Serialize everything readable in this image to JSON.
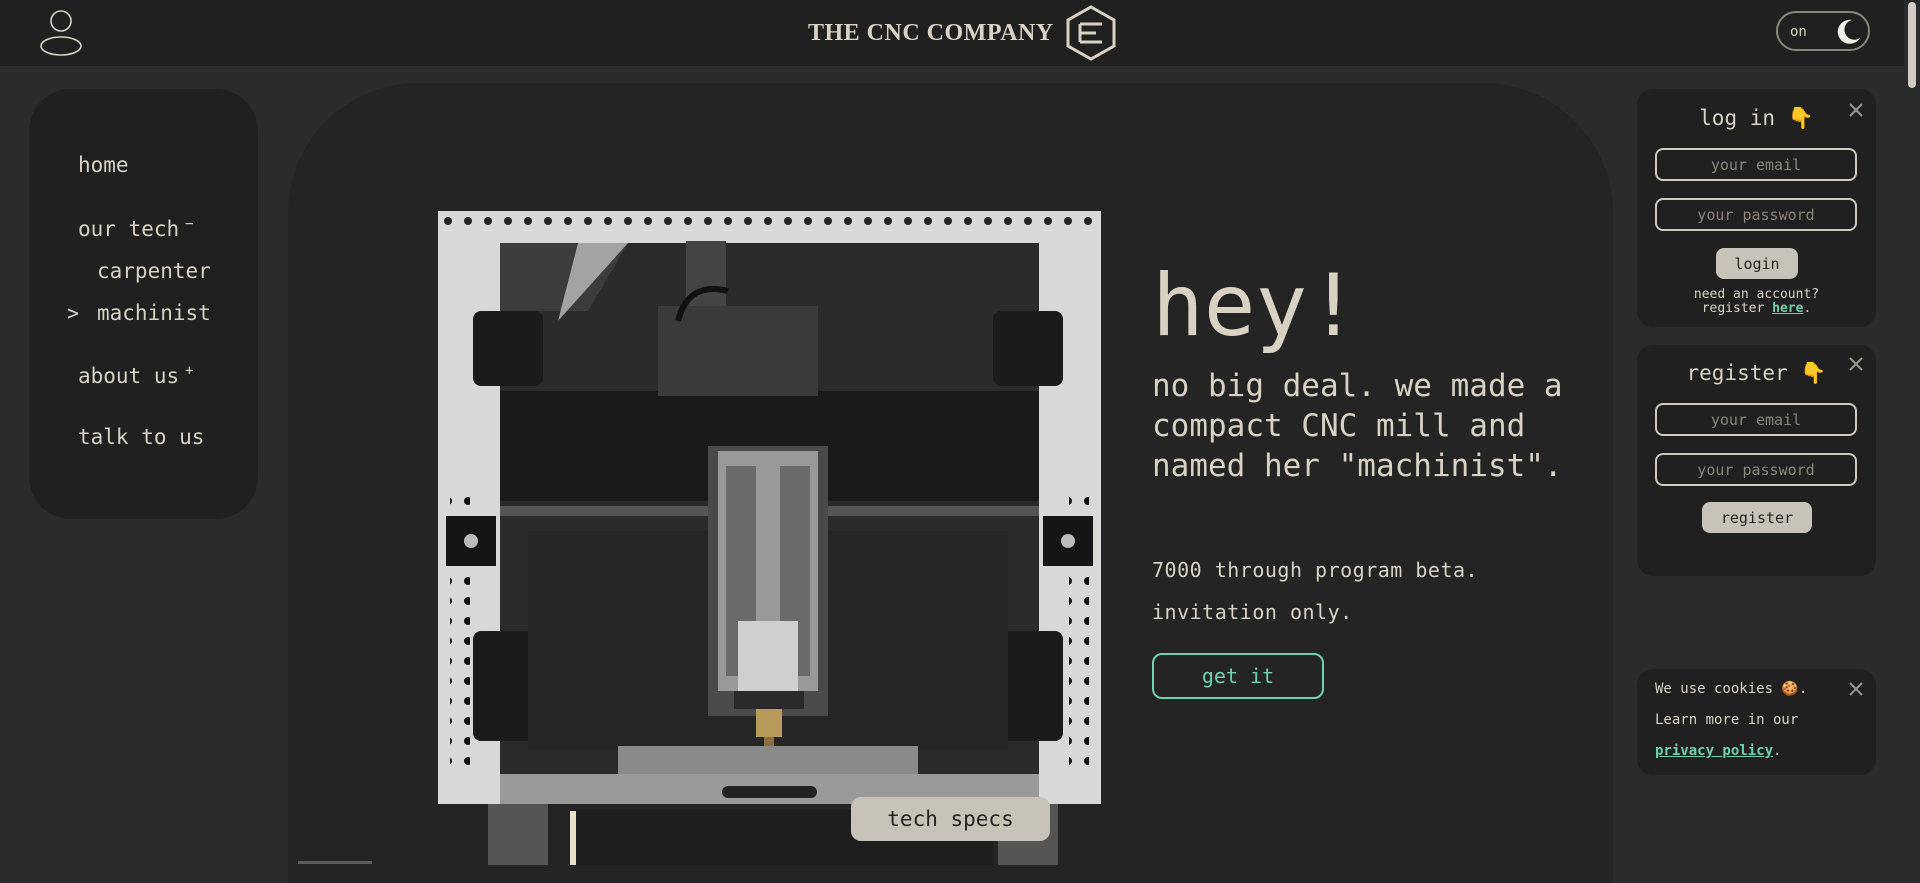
{
  "header": {
    "brand": "THE CNC COMPANY",
    "theme_toggle_label": "on",
    "icons": {
      "account": "user-icon",
      "logo": "cnc-logo-icon",
      "theme": "moon-icon"
    }
  },
  "nav": {
    "home": "home",
    "our_tech": "our tech",
    "our_tech_marker": "−",
    "carpenter": "carpenter",
    "machinist_arrow": ">",
    "machinist": "machinist",
    "about_us": "about us",
    "about_us_marker": "+",
    "talk_to_us": "talk to us"
  },
  "hero": {
    "title": "hey!",
    "subtitle": "no big deal. we made a compact CNC mill and named her \"machinist\".",
    "line1": "7000 through program beta.",
    "line2": "invitation only.",
    "cta": "get it",
    "tech_specs": "tech specs"
  },
  "login": {
    "title": "log in",
    "title_emoji": "👇",
    "email_placeholder": "your email",
    "password_placeholder": "your password",
    "button": "login",
    "need_account": "need an account?",
    "register_prefix": "register ",
    "register_link": "here",
    "register_suffix": "."
  },
  "register": {
    "title": "register",
    "title_emoji": "👇",
    "email_placeholder": "your email",
    "password_placeholder": "your password",
    "button": "register"
  },
  "cookies": {
    "line1": "We use cookies 🍪.",
    "line2": "Learn more in our",
    "link": "privacy policy",
    "suffix": "."
  },
  "colors": {
    "accent": "#6fd1b2",
    "background": "#2a2c2b",
    "panel": "#1f201f",
    "text": "#d9d2c3"
  }
}
